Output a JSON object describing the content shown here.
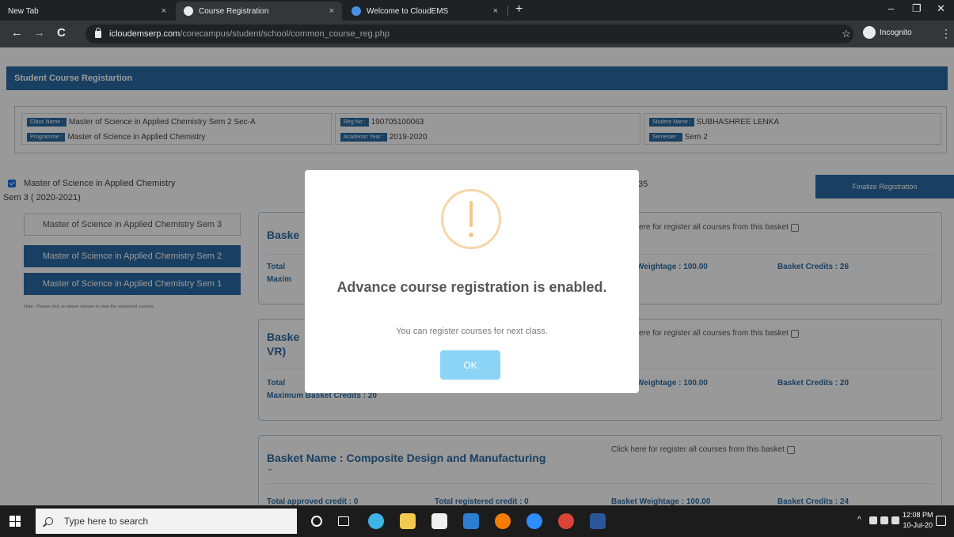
{
  "browser": {
    "tabs": [
      {
        "label": "New Tab",
        "close": "×"
      },
      {
        "label": "Course Registration",
        "close": "×"
      },
      {
        "label": "Welcome to CloudEMS",
        "close": "×"
      }
    ],
    "new_tab": "+",
    "window_controls": {
      "minimize": "–",
      "maximize": "❐",
      "close": "✕"
    },
    "nav": {
      "back": "←",
      "forward": "→",
      "reload": "C"
    },
    "url_host": "icloudemserp.com",
    "url_path": "/corecampus/student/school/common_course_reg.php",
    "star": "☆",
    "profile_label": "Incognito",
    "menu": "⋮"
  },
  "page": {
    "header_title": "Student Course Registartion",
    "info": {
      "class_name_label": "Class Name :",
      "class_name": "Master of Science in Applied Chemistry Sem 2 Sec-A",
      "programme_label": "Programme :",
      "programme": "Master of Science in Applied Chemistry",
      "regno_label": "Reg.No :",
      "regno": "190705100063",
      "academic_year_label": "Academic Year :",
      "academic_year": "2019-2020",
      "student_name_label": "Student Name :",
      "student_name": "SUBHASHREE LENKA",
      "semester_label": "Semester :",
      "semester": "Sem 2"
    },
    "next_class_line1": "Master of Science in Applied Chemistry",
    "next_class_line2": "Sem 3 ( 2020-2021)",
    "partial_35": "35",
    "finalize_label": "Finalize Registration",
    "sem_buttons": [
      "Master of Science in Applied Chemistry Sem 3",
      "Master of Science in Applied Chemistry Sem 2",
      "Master of Science in Applied Chemistry Sem 1"
    ],
    "note": "Note : Please click on above classes to view the registered courses.",
    "baskets": [
      {
        "name": "Baske",
        "click": "ere for register all courses from this basket",
        "total": "Total",
        "max": "Maxim",
        "weightage": "Weightage : 100.00",
        "credits": "Basket Credits : 26"
      },
      {
        "name": "Baske",
        "name2": "VR)",
        "click": "ere for register all courses from this basket",
        "total": "Total",
        "max": "Maximum Basket Credits : 20",
        "weightage": "Weightage : 100.00",
        "credits": "Basket Credits : 20"
      },
      {
        "name": "Basket Name : Composite Design and Manufacturing",
        "click": "Click here for register all courses from this basket",
        "approved": "Total approved credit : 0",
        "registered": "Total registered credit : 0",
        "weightage": "Basket Weightage : 100.00",
        "credits": "Basket Credits : 24"
      }
    ],
    "chevron": "⌄"
  },
  "modal": {
    "title": "Advance course registration is enabled.",
    "text": "You can register courses for next class.",
    "ok_label": "OK",
    "icon": "warning-icon",
    "icon_color": "#f8bb86"
  },
  "taskbar": {
    "search_placeholder": "Type here to search",
    "tray_up": "^",
    "time": "12:08 PM",
    "date": "10-Jul-20"
  },
  "colors": {
    "primary": "#2b6ca3",
    "ok_button": "#8cd4f5"
  }
}
